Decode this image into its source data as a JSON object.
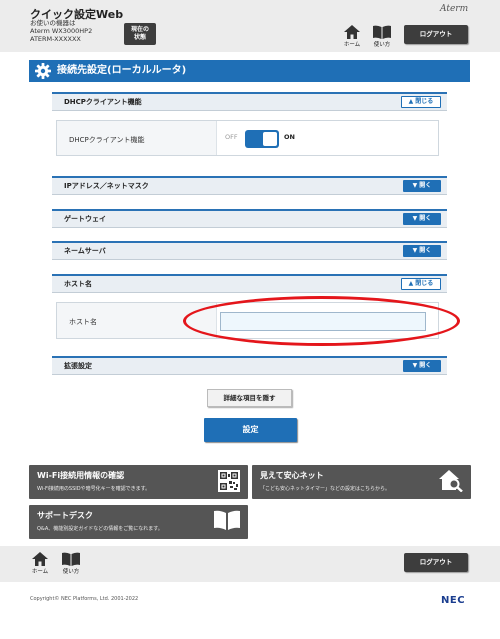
{
  "header": {
    "title": "クイック設定Web",
    "device_line1": "お使いの機器は",
    "device_line2": "Aterm  WX3000HP2",
    "device_line3": "ATERM-XXXXXX",
    "status_button_line1": "現在の",
    "status_button_line2": "状態",
    "brand": "Aterm",
    "home_label": "ホーム",
    "manual_label": "使い方",
    "logout_label": "ログアウト"
  },
  "page_title": "接続先設定(ローカルルータ)",
  "sections": {
    "dhcp": {
      "title": "DHCPクライアント機能",
      "button": "閉じる"
    },
    "dhcp_field": {
      "label": "DHCPクライアント機能",
      "off": "OFF",
      "on": "ON"
    },
    "ip": {
      "title": "IPアドレス／ネットマスク",
      "button": "開く"
    },
    "gateway": {
      "title": "ゲートウェイ",
      "button": "開く"
    },
    "nameserver": {
      "title": "ネームサーバ",
      "button": "開く"
    },
    "hostname": {
      "title": "ホスト名",
      "button": "閉じる"
    },
    "hostname_field": {
      "label": "ホスト名",
      "value": ""
    },
    "extended": {
      "title": "拡張設定",
      "button": "開く"
    }
  },
  "buttons": {
    "hide_details": "詳細な項目を隠す",
    "submit": "設定"
  },
  "cards": {
    "wifi": {
      "title": "Wi-Fi接続用情報の確認",
      "desc": "Wi-Fi接続用のSSIDや暗号化キーを確認できます。"
    },
    "safety": {
      "title": "見えて安心ネット",
      "desc": "「こども安心ネットタイマー」などの設定はこちらから。"
    },
    "support": {
      "title": "サポートデスク",
      "desc": "Q&A、機能別設定ガイドなどの情報をご覧になれます。"
    }
  },
  "footer": {
    "home_label": "ホーム",
    "manual_label": "使い方",
    "logout_label": "ログアウト",
    "copyright": "Copyright© NEC Platforms, Ltd. 2001-2022",
    "logo": "NEC"
  },
  "colors": {
    "accent": "#1f6fb6",
    "highlight_ring": "#e4161b",
    "card_bg": "#555555"
  }
}
